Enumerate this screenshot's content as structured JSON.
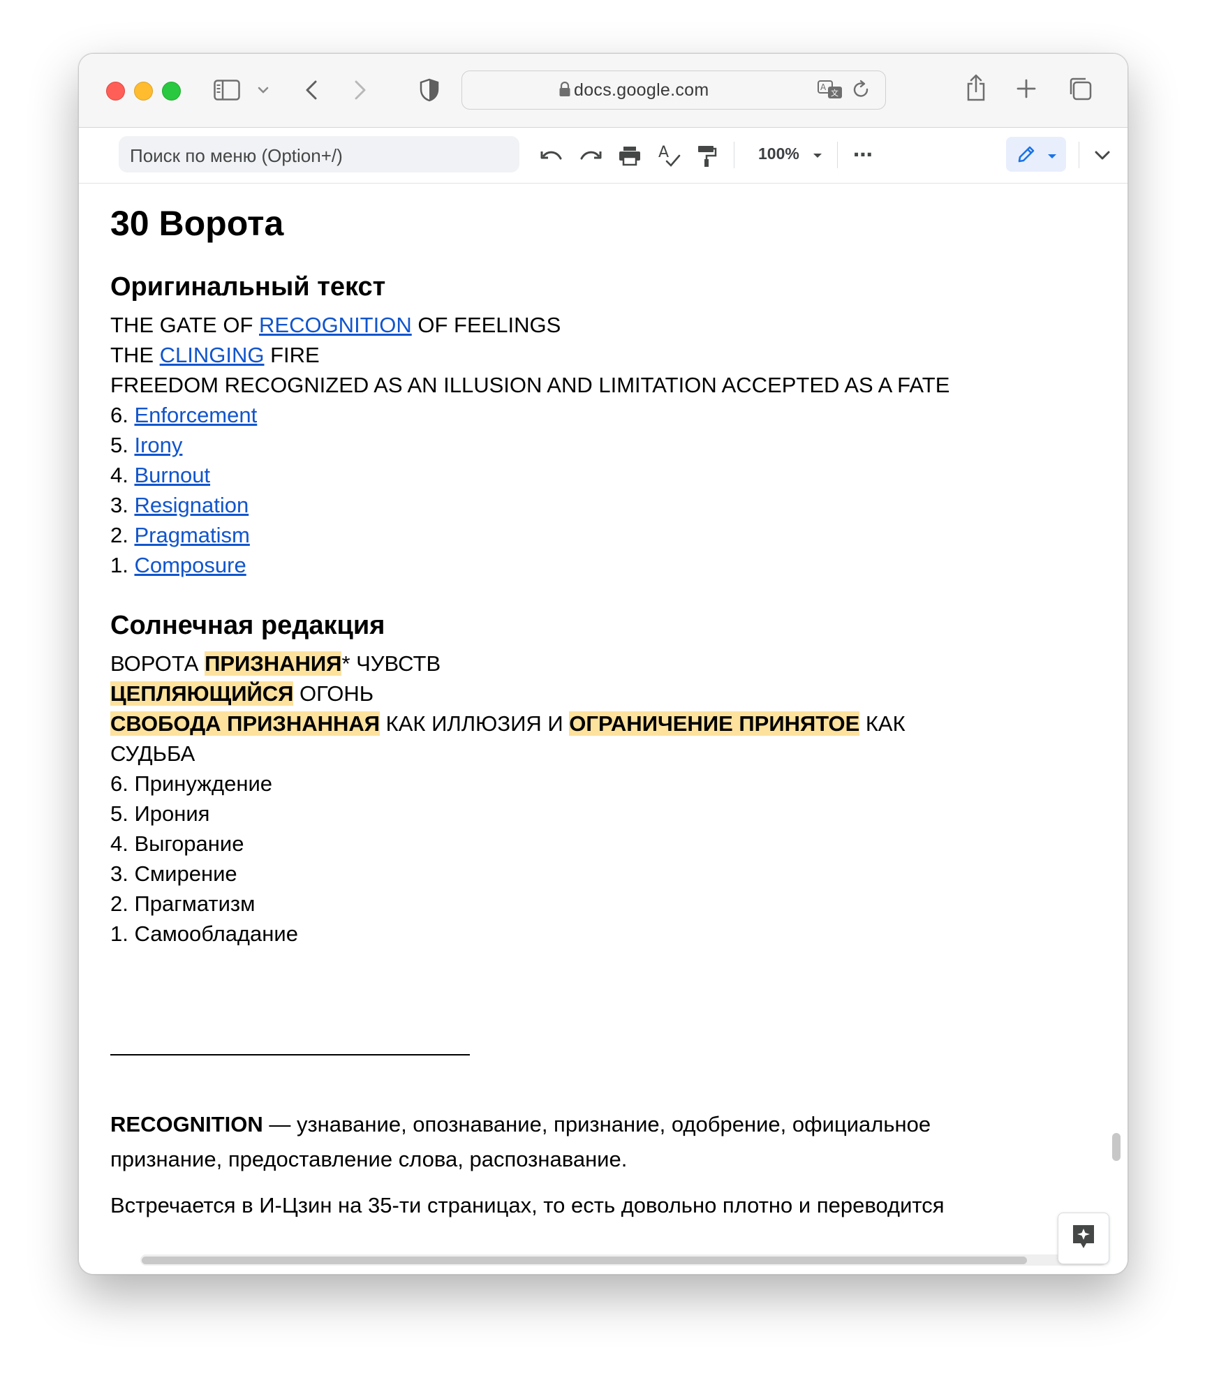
{
  "browser": {
    "url": "docs.google.com",
    "icons": [
      "sidebar-icon",
      "chevron-down-icon",
      "back-icon",
      "forward-icon",
      "shield-icon",
      "lock-icon",
      "translate-icon",
      "reload-icon",
      "share-icon",
      "plus-icon",
      "tabs-icon"
    ]
  },
  "docs_toolbar": {
    "menu_search_placeholder": "Поиск по меню (Option+/)",
    "zoom": "100%",
    "more": "⋯"
  },
  "document": {
    "title": "30 Ворота",
    "original": {
      "heading": "Оригинальный текст",
      "line1": [
        "THE GATE OF ",
        "RECOGNITION",
        " OF FEELINGS"
      ],
      "line2": [
        "THE ",
        "CLINGING",
        " FIRE"
      ],
      "line3": "FREEDOM RECOGNIZED AS AN ILLUSION AND LIMITATION ACCEPTED AS A FATE",
      "lines": [
        {
          "num": "6. ",
          "text": "Enforcement"
        },
        {
          "num": "5. ",
          "text": "Irony"
        },
        {
          "num": "4. ",
          "text": "Burnout"
        },
        {
          "num": "3. ",
          "text": "Resignation"
        },
        {
          "num": "2. ",
          "text": "Pragmatism"
        },
        {
          "num": "1. ",
          "text": "Composure"
        }
      ]
    },
    "solar": {
      "heading": "Солнечная редакция",
      "line1": [
        "ВОРОТА ",
        "ПРИЗНАНИЯ",
        "* ЧУВСТВ"
      ],
      "line2": [
        "ЦЕПЛЯЮЩИЙСЯ",
        " ОГОНЬ"
      ],
      "line3": [
        "СВОБОДА ПРИЗНАННАЯ",
        " КАК ИЛЛЮЗИЯ И ",
        "ОГРАНИЧЕНИЕ ПРИНЯТОЕ",
        " КАК"
      ],
      "line4": "СУДЬБА",
      "lines": [
        "6. Принуждение",
        "5. Ирония",
        "4. Выгорание",
        "3. Смирение",
        "2. Прагматизм",
        "1. Самообладание"
      ]
    },
    "footnote": {
      "term": "RECOGNITION",
      "dash": " — узнавание, опознавание, признание, одобрение, официальное",
      "cont": "признание, предоставление слова, распознавание.",
      "next": "Встречается в И-Цзин на 35-ти страницах, то есть довольно плотно и переводится"
    }
  },
  "colors": {
    "link": "#1155cc",
    "highlight": "#fde29d",
    "edit_mode_bg": "#e8eefc",
    "edit_mode_icon": "#1a73e8"
  }
}
